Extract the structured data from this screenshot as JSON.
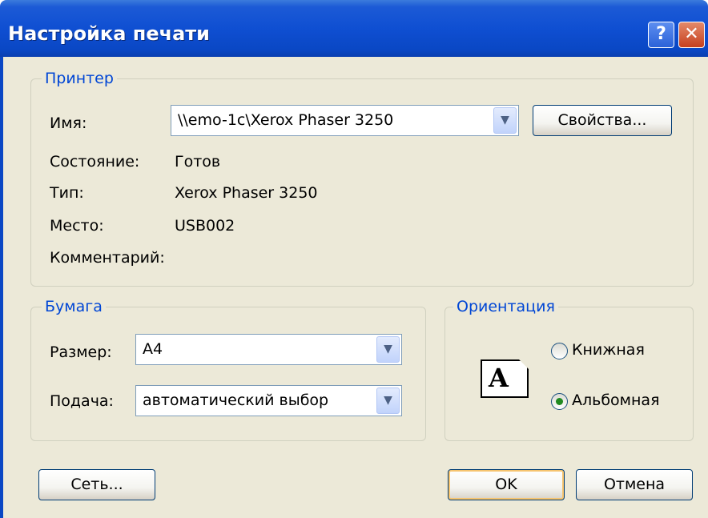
{
  "window": {
    "title": "Настройка печати",
    "help_label": "?",
    "close_label": "✕"
  },
  "printer": {
    "legend": "Принтер",
    "name_label": "Имя:",
    "name_value": "\\\\emo-1c\\Xerox Phaser 3250",
    "properties_button": "Свойства...",
    "status_label": "Состояние:",
    "status_value": "Готов",
    "type_label": "Тип:",
    "type_value": "Xerox Phaser 3250",
    "where_label": "Место:",
    "where_value": "USB002",
    "comment_label": "Комментарий:"
  },
  "paper": {
    "legend": "Бумага",
    "size_label": "Размер:",
    "size_value": "A4",
    "source_label": "Подача:",
    "source_value": "автоматический выбор"
  },
  "orientation": {
    "legend": "Ориентация",
    "portrait_label": "Книжная",
    "landscape_label": "Альбомная",
    "selected": "landscape",
    "icon_letter": "A"
  },
  "footer": {
    "network_button": "Сеть...",
    "ok_button": "OK",
    "cancel_button": "Отмена"
  },
  "icons": {
    "dropdown_arrow": "chevron-down-icon",
    "orientation_preview": "page-landscape-icon"
  }
}
